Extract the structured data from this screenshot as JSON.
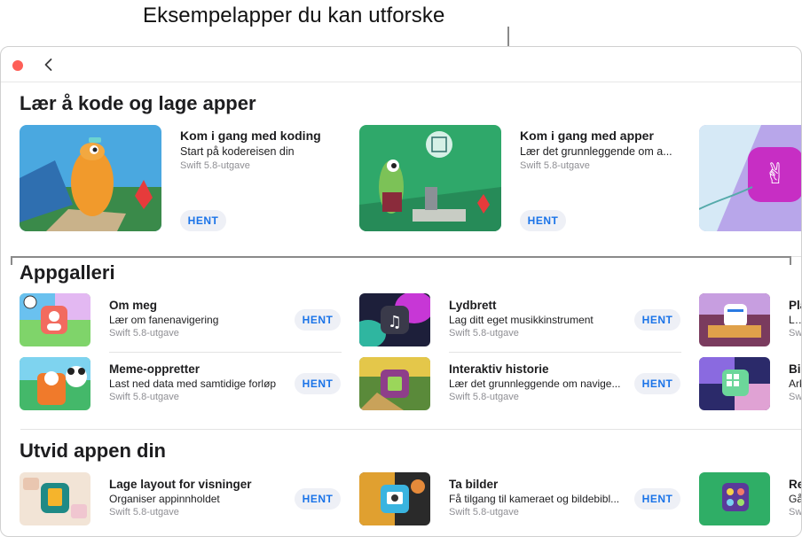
{
  "callout": {
    "label": "Eksempelapper du kan utforske"
  },
  "sections": {
    "learn": {
      "title": "Lær å kode og lage apper",
      "cards": [
        {
          "title": "Kom i gang med koding",
          "subtitle": "Start på kodereisen din",
          "version": "Swift 5.8-utgave",
          "button": "HENT"
        },
        {
          "title": "Kom i gang med apper",
          "subtitle": "Lær det grunnleggende om a...",
          "version": "Swift 5.8-utgave",
          "button": "HENT"
        }
      ]
    },
    "gallery": {
      "title": "Appgalleri",
      "items": [
        {
          "title": "Om meg",
          "subtitle": "Lær om fanenavigering",
          "version": "Swift 5.8-utgave",
          "button": "HENT"
        },
        {
          "title": "Lydbrett",
          "subtitle": "Lag ditt eget musikkinstrument",
          "version": "Swift 5.8-utgave",
          "button": "HENT"
        },
        {
          "title": "Pla",
          "subtitle": "Lag",
          "version": "Swi"
        },
        {
          "title": "Meme-oppretter",
          "subtitle": "Last ned data med samtidige forløp",
          "version": "Swift 5.8-utgave",
          "button": "HENT"
        },
        {
          "title": "Interaktiv historie",
          "subtitle": "Lær det grunnleggende om navige...",
          "version": "Swift 5.8-utgave",
          "button": "HENT"
        },
        {
          "title": "Bil",
          "subtitle": "Ark",
          "version": "Swi"
        }
      ]
    },
    "extend": {
      "title": "Utvid appen din",
      "items": [
        {
          "title": "Lage layout for visninger",
          "subtitle": "Organiser appinnholdet",
          "version": "Swift 5.8-utgave",
          "button": "HENT"
        },
        {
          "title": "Ta bilder",
          "subtitle": "Få tilgang til kameraet og bildebibl...",
          "version": "Swift 5.8-utgave",
          "button": "HENT"
        },
        {
          "title": "Re",
          "subtitle": "Gå",
          "version": "Swi"
        }
      ]
    }
  },
  "colors": {
    "accent": "#1a73e8",
    "close": "#fe5f57",
    "button_bg": "#eef0f6"
  }
}
